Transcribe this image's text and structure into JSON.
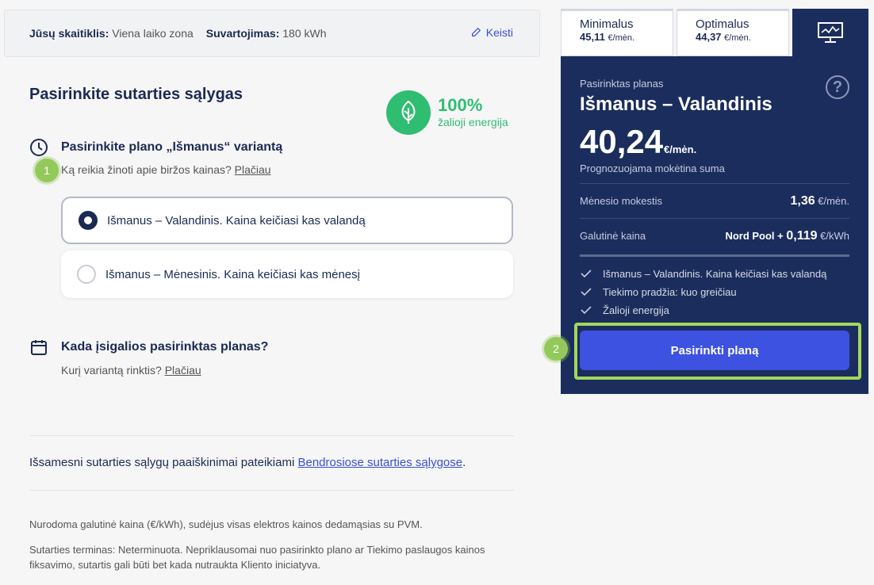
{
  "meter": {
    "label1": "Jūsų skaitiklis:",
    "value1": "Viena laiko zona",
    "label2": "Suvartojimas:",
    "value2": "180 kWh",
    "edit_label": "Keisti"
  },
  "section_title": "Pasirinkite sutarties sąlygas",
  "green": {
    "percent": "100%",
    "label": "žalioji energija",
    "color": "#2fbd71"
  },
  "q1": {
    "title": "Pasirinkite plano „Išmanus“ variantą",
    "sub_text": "Ką reikia žinoti apie biržos kainas?",
    "sub_link": "Plačiau",
    "step": "1"
  },
  "options": [
    {
      "label": "Išmanus – Valandinis. Kaina keičiasi kas valandą",
      "selected": true
    },
    {
      "label": "Išmanus – Mėnesinis. Kaina keičiasi kas mėnesį",
      "selected": false
    }
  ],
  "q2": {
    "title": "Kada įsigalios pasirinktas planas?",
    "sub_text": "Kurį variantą rinktis?",
    "sub_link": "Plačiau"
  },
  "terms": {
    "text": "Išsamesni sutarties sąlygų paaiškinimai pateikiami",
    "link": "Bendrosiose sutarties sąlygose",
    "end": "."
  },
  "fine": {
    "line1": "Nurodoma galutinė kaina (€/kWh), sudėjus visas elektros kainos dedamąsias su PVM.",
    "line2": "Sutarties terminas: Neterminuota. Nepriklausomai nuo pasirinkto plano ar Tiekimo paslaugos kainos fiksavimo, sutartis gali būti bet kada nutraukta Kliento iniciatyva."
  },
  "tabs": [
    {
      "name": "Minimalus",
      "price": "45,11",
      "unit": "€/mėn."
    },
    {
      "name": "Optimalus",
      "price": "44,37",
      "unit": "€/mėn."
    }
  ],
  "panel": {
    "label": "Pasirinktas planas",
    "name": "Išmanus – Valandinis",
    "help": "?",
    "price": "40,24",
    "price_unit": "€/mėn.",
    "forecast": "Prognozuojama mokėtina suma",
    "monthly_label": "Mėnesio mokestis",
    "monthly_value": "1,36",
    "monthly_unit": "€/mėn.",
    "final_label": "Galutinė kaina",
    "final_prefix": "Nord Pool +",
    "final_value": "0,119",
    "final_unit": "€/kWh",
    "features": [
      "Išmanus – Valandinis. Kaina keičiasi kas valandą",
      "Tiekimo pradžia: kuo greičiau",
      "Žalioji energija"
    ],
    "cta": "Pasirinkti planą",
    "step": "2"
  },
  "colors": {
    "navy": "#1b2d5c",
    "accent": "#3d52e0",
    "highlight": "#a4d65e"
  }
}
